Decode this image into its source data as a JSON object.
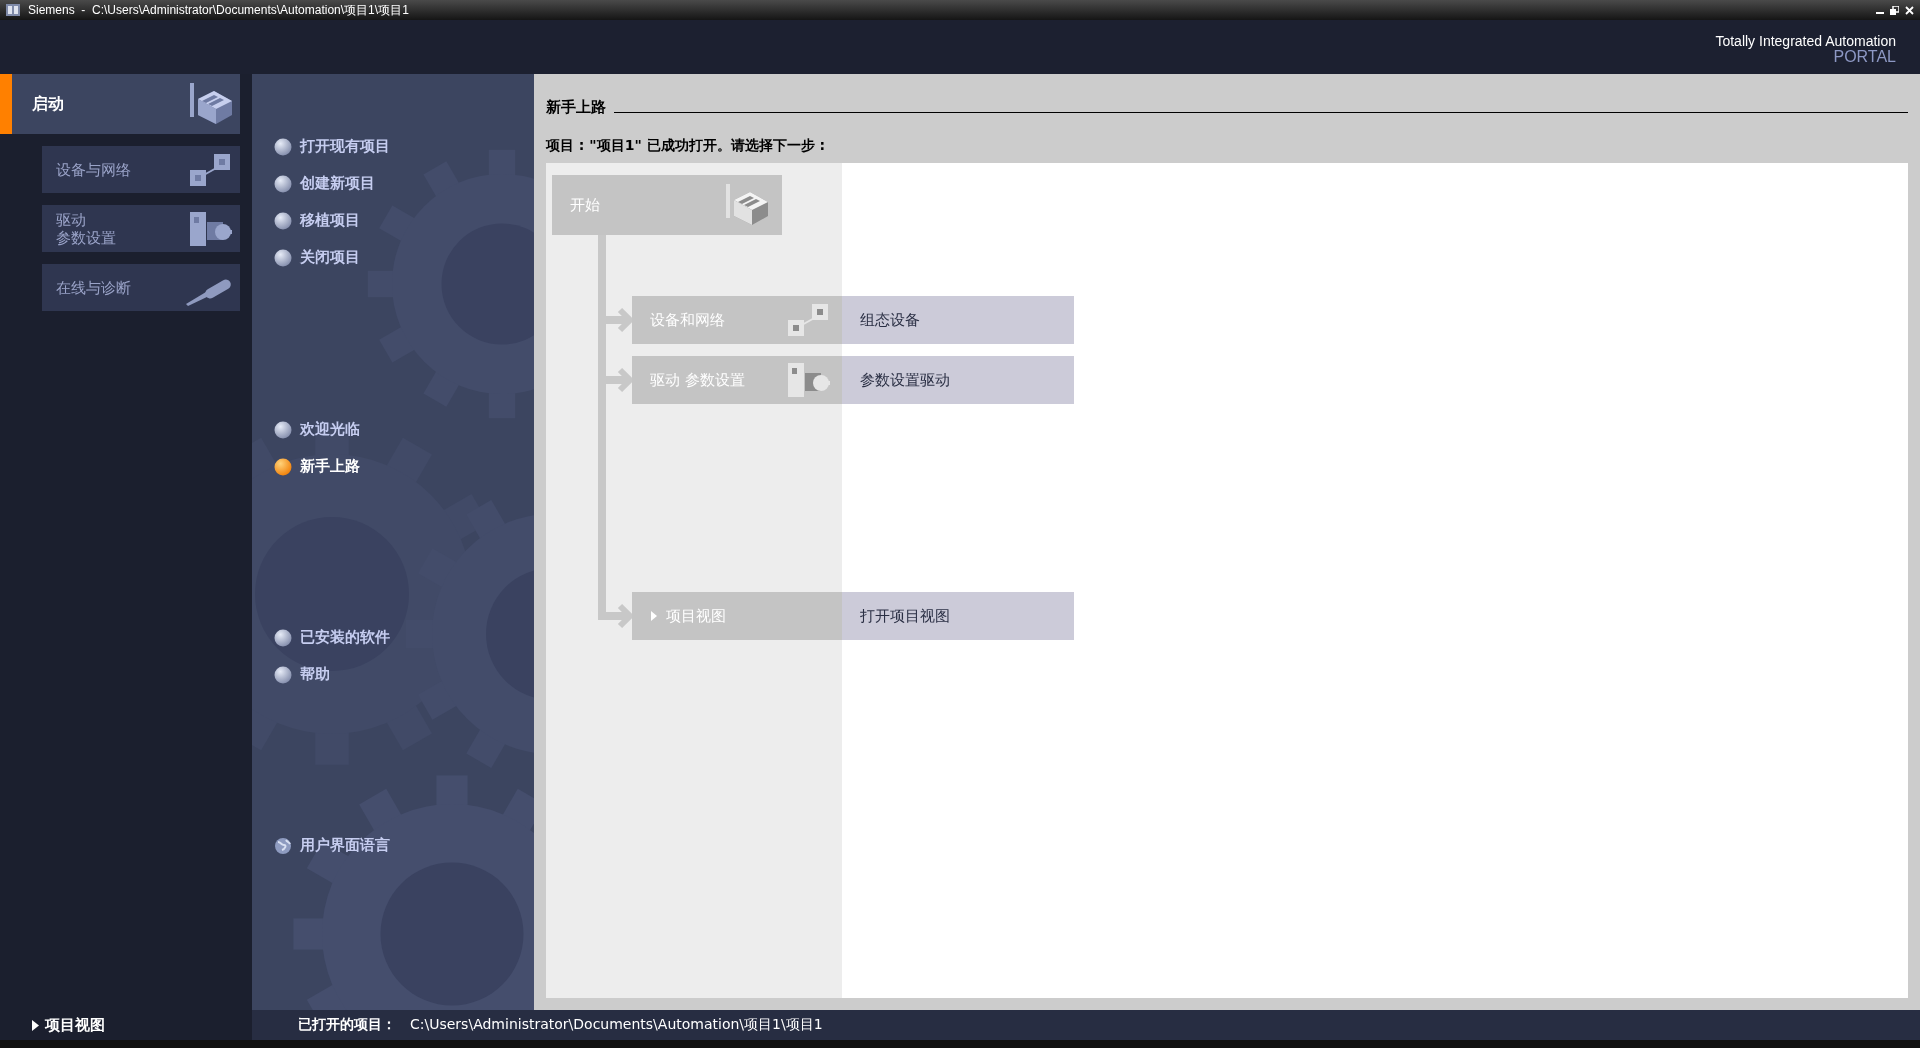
{
  "window": {
    "app": "Siemens",
    "separator": "-",
    "path": "C:\\Users\\Administrator\\Documents\\Automation\\项目1\\项目1"
  },
  "branding": {
    "line1": "Totally Integrated Automation",
    "line2": "PORTAL"
  },
  "portals": [
    {
      "label": "启动",
      "selected": true,
      "kind": "start"
    }
  ],
  "portal_items": [
    {
      "label": "设备与网络",
      "selected": false,
      "kind": "devices"
    },
    {
      "label_lines": [
        "驱动",
        "参数设置"
      ],
      "selected": false,
      "kind": "drive"
    },
    {
      "label": "在线与诊断",
      "selected": false,
      "kind": "diagnostics"
    }
  ],
  "menu_groups": [
    [
      {
        "label": "打开现有项目",
        "selected": false,
        "kind": "bullet"
      },
      {
        "label": "创建新项目",
        "selected": false,
        "kind": "bullet"
      },
      {
        "label": "移植项目",
        "selected": false,
        "kind": "bullet"
      },
      {
        "label": "关闭项目",
        "selected": false,
        "kind": "bullet"
      }
    ],
    [
      {
        "label": "欢迎光临",
        "selected": false,
        "kind": "bullet"
      },
      {
        "label": "新手上路",
        "selected": true,
        "kind": "bullet"
      }
    ],
    [
      {
        "label": "已安装的软件",
        "selected": false,
        "kind": "bullet"
      },
      {
        "label": "帮助",
        "selected": false,
        "kind": "bullet"
      }
    ],
    [
      {
        "label": "用户界面语言",
        "selected": false,
        "kind": "globe"
      }
    ]
  ],
  "content": {
    "heading": "新手上路",
    "message": "项目 : \"项目1\" 已成功打开。请选择下一步 :",
    "start_node": {
      "label": "开始",
      "kind": "start"
    },
    "steps": [
      {
        "label": "设备和网络",
        "action": "组态设备",
        "kind": "devices"
      },
      {
        "label": "驱动 参数设置",
        "action": "参数设置驱动",
        "kind": "drive"
      },
      {
        "label": "项目视图",
        "action": "打开项目视图",
        "kind": "view"
      }
    ]
  },
  "footer": {
    "view_link": "项目视图",
    "status_label": "已打开的项目：",
    "status_path": "C:\\Users\\Administrator\\Documents\\Automation\\项目1\\项目1"
  }
}
